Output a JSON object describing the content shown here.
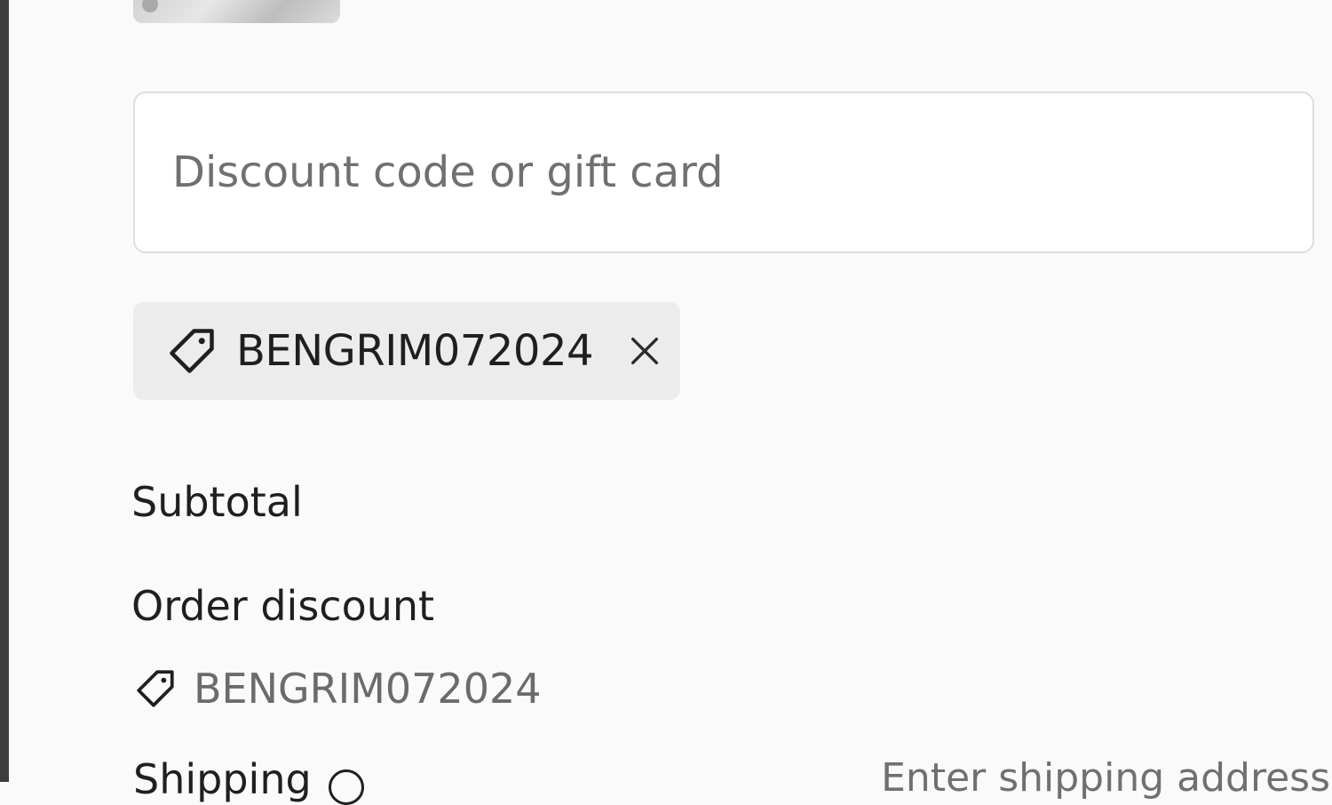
{
  "discount": {
    "placeholder": "Discount code or gift card",
    "value": ""
  },
  "applied_tag": {
    "code": "BENGRIM072024",
    "remove_icon": "close-icon",
    "icon": "tag-icon"
  },
  "summary": {
    "subtotal_label": "Subtotal",
    "order_discount_label": "Order discount",
    "order_discount_code": "BENGRIM072024",
    "shipping_label": "Shipping",
    "shipping_status": "Enter shipping address"
  }
}
